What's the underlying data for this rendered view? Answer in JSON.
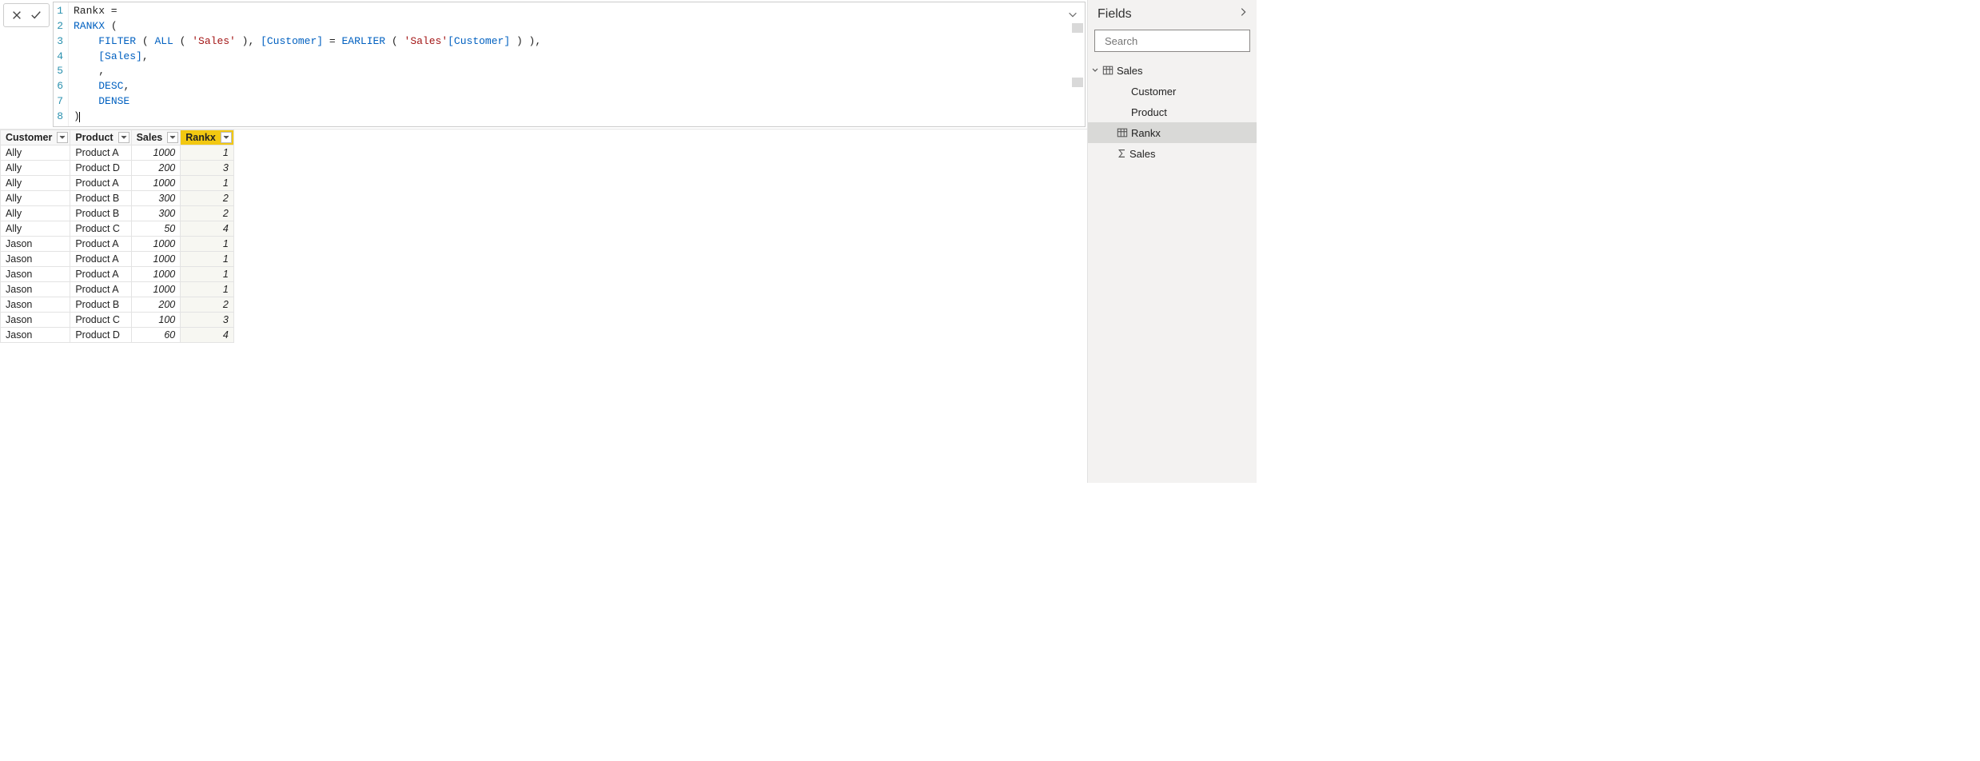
{
  "formula_bar": {
    "lines": [
      [
        {
          "t": "plain",
          "v": "Rankx = "
        }
      ],
      [
        {
          "t": "kw",
          "v": "RANKX"
        },
        {
          "t": "plain",
          "v": " ("
        }
      ],
      [
        {
          "t": "plain",
          "v": "    "
        },
        {
          "t": "kw",
          "v": "FILTER"
        },
        {
          "t": "plain",
          "v": " ( "
        },
        {
          "t": "kw",
          "v": "ALL"
        },
        {
          "t": "plain",
          "v": " ( "
        },
        {
          "t": "str",
          "v": "'Sales'"
        },
        {
          "t": "plain",
          "v": " ), "
        },
        {
          "t": "col",
          "v": "[Customer]"
        },
        {
          "t": "plain",
          "v": " = "
        },
        {
          "t": "kw",
          "v": "EARLIER"
        },
        {
          "t": "plain",
          "v": " ( "
        },
        {
          "t": "str",
          "v": "'Sales'"
        },
        {
          "t": "col",
          "v": "[Customer]"
        },
        {
          "t": "plain",
          "v": " ) ),"
        }
      ],
      [
        {
          "t": "plain",
          "v": "    "
        },
        {
          "t": "col",
          "v": "[Sales]"
        },
        {
          "t": "plain",
          "v": ","
        }
      ],
      [
        {
          "t": "plain",
          "v": "    ,"
        }
      ],
      [
        {
          "t": "plain",
          "v": "    "
        },
        {
          "t": "kw",
          "v": "DESC"
        },
        {
          "t": "plain",
          "v": ","
        }
      ],
      [
        {
          "t": "plain",
          "v": "    "
        },
        {
          "t": "kw",
          "v": "DENSE"
        }
      ],
      [
        {
          "t": "plain",
          "v": ")"
        }
      ]
    ]
  },
  "table": {
    "columns": [
      {
        "name": "Customer",
        "align": "left",
        "selected": false
      },
      {
        "name": "Product",
        "align": "left",
        "selected": false
      },
      {
        "name": "Sales",
        "align": "right",
        "selected": false
      },
      {
        "name": "Rankx",
        "align": "right",
        "selected": true
      }
    ],
    "rows": [
      {
        "Customer": "Ally",
        "Product": "Product A",
        "Sales": 1000,
        "Rankx": 1
      },
      {
        "Customer": "Ally",
        "Product": "Product D",
        "Sales": 200,
        "Rankx": 3
      },
      {
        "Customer": "Ally",
        "Product": "Product A",
        "Sales": 1000,
        "Rankx": 1
      },
      {
        "Customer": "Ally",
        "Product": "Product B",
        "Sales": 300,
        "Rankx": 2
      },
      {
        "Customer": "Ally",
        "Product": "Product B",
        "Sales": 300,
        "Rankx": 2
      },
      {
        "Customer": "Ally",
        "Product": "Product C",
        "Sales": 50,
        "Rankx": 4
      },
      {
        "Customer": "Jason",
        "Product": "Product A",
        "Sales": 1000,
        "Rankx": 1
      },
      {
        "Customer": "Jason",
        "Product": "Product A",
        "Sales": 1000,
        "Rankx": 1
      },
      {
        "Customer": "Jason",
        "Product": "Product A",
        "Sales": 1000,
        "Rankx": 1
      },
      {
        "Customer": "Jason",
        "Product": "Product A",
        "Sales": 1000,
        "Rankx": 1
      },
      {
        "Customer": "Jason",
        "Product": "Product B",
        "Sales": 200,
        "Rankx": 2
      },
      {
        "Customer": "Jason",
        "Product": "Product C",
        "Sales": 100,
        "Rankx": 3
      },
      {
        "Customer": "Jason",
        "Product": "Product D",
        "Sales": 60,
        "Rankx": 4
      }
    ]
  },
  "fields": {
    "title": "Fields",
    "search_placeholder": "Search",
    "table_name": "Sales",
    "items": [
      {
        "label": "Customer",
        "icon": "none",
        "selected": false
      },
      {
        "label": "Product",
        "icon": "none",
        "selected": false
      },
      {
        "label": "Rankx",
        "icon": "calc",
        "selected": true
      },
      {
        "label": "Sales",
        "icon": "sigma",
        "selected": false
      }
    ]
  }
}
